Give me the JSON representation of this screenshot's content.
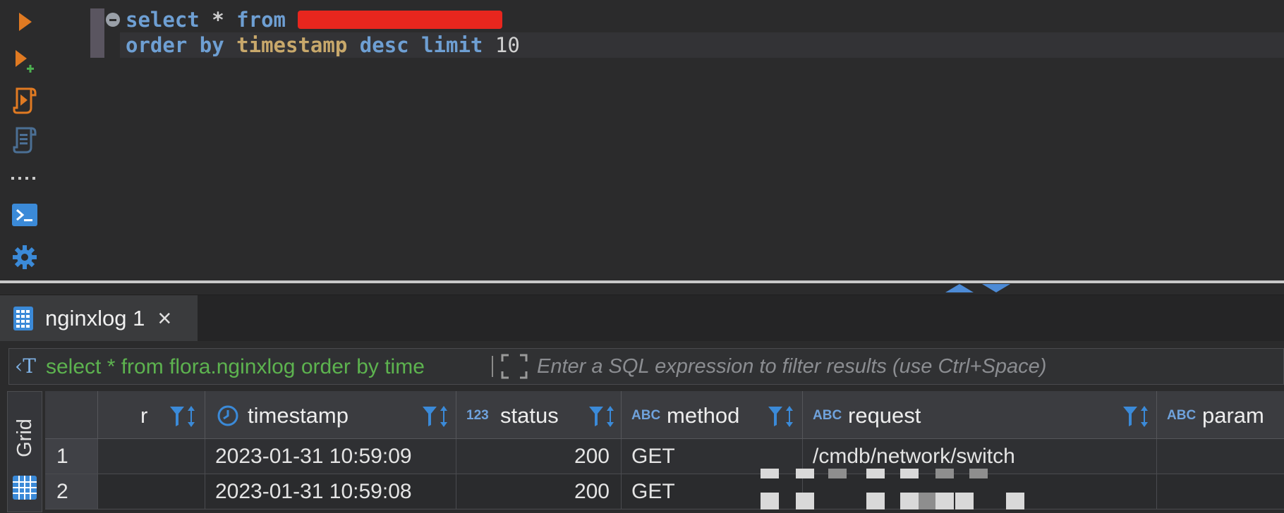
{
  "editor": {
    "line1": {
      "kw_select": "select",
      "star": "*",
      "kw_from": "from"
    },
    "line2": {
      "kw_order": "order",
      "kw_by": "by",
      "column": "timestamp",
      "kw_desc": "desc",
      "kw_limit": "limit",
      "limit_value": "10"
    }
  },
  "toolbar": {
    "items": [
      "execute-icon",
      "execute-new-tab-icon",
      "execute-script-icon",
      "script-icon",
      "more-icon",
      "terminal-icon",
      "settings-icon"
    ]
  },
  "results": {
    "tab_label": "nginxlog 1",
    "close_glyph": "×",
    "filter_query": "select * from flora.nginxlog order by time",
    "filter_placeholder": "Enter a SQL expression to filter results (use Ctrl+Space)",
    "view_mode_label": "Grid",
    "columns": [
      {
        "type": "",
        "name": "r"
      },
      {
        "type": "clock",
        "name": "timestamp"
      },
      {
        "type": "123",
        "name": "status"
      },
      {
        "type": "ABC",
        "name": "method"
      },
      {
        "type": "ABC",
        "name": "request"
      },
      {
        "type": "ABC",
        "name": "param"
      }
    ],
    "rows": [
      {
        "num": "1",
        "timestamp": "2023-01-31 10:59:09",
        "status": "200",
        "method": "GET",
        "request": "/cmdb/network/switch",
        "param": ""
      },
      {
        "num": "2",
        "timestamp": "2023-01-31 10:59:08",
        "status": "200",
        "method": "GET",
        "request": "",
        "param": ""
      }
    ]
  },
  "colors": {
    "accent": "#4d8bd6",
    "keyword": "#6e9fd3",
    "function": "#c8a86b",
    "filter_query": "#5db34f",
    "redaction": "#e8261e"
  }
}
